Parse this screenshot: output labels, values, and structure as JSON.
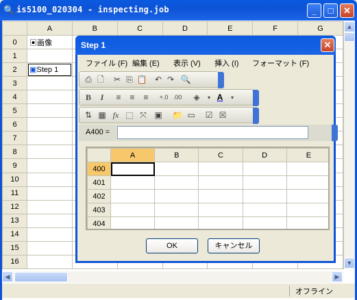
{
  "main_window": {
    "title": "is5100_020304 - inspecting.job",
    "buttons": {
      "minimize": "_",
      "maximize": "□",
      "close": "✕"
    },
    "columns": [
      "A",
      "B",
      "C",
      "D",
      "E",
      "F",
      "G"
    ],
    "rows": [
      "0",
      "1",
      "2",
      "3",
      "4",
      "5",
      "6",
      "7",
      "8",
      "9",
      "10",
      "11",
      "12",
      "13",
      "14",
      "15",
      "16"
    ],
    "cells": {
      "A0": "画像",
      "A2": "Step 1"
    },
    "status": "オフライン"
  },
  "dialog": {
    "title": "Step 1",
    "menu": [
      "ファイル (F)",
      "編集 (E)",
      "表示 (V)",
      "挿入 (I)",
      "フォーマット (F)"
    ],
    "formula_label": "A400 =",
    "formula_value": "",
    "sheet": {
      "columns": [
        "A",
        "B",
        "C",
        "D",
        "E"
      ],
      "rows": [
        "400",
        "401",
        "402",
        "403",
        "404"
      ]
    },
    "ok_label": "OK",
    "cancel_label": "キャンセル"
  }
}
